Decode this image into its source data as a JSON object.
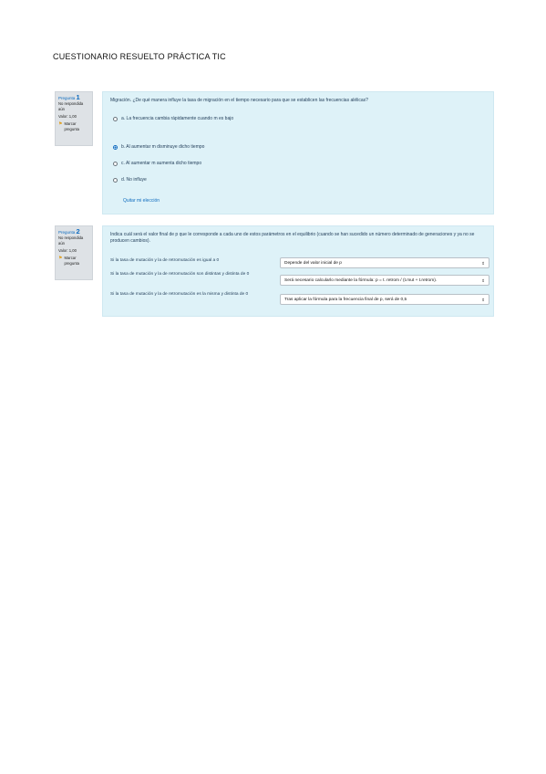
{
  "document": {
    "title": "CUESTIONARIO RESUELTO PRÁCTICA TIC"
  },
  "questions": [
    {
      "label": "Pregunta",
      "number": "1",
      "status": "No respondida aún",
      "grade": "Valor: 1,00",
      "flag_label": "Marcar pregunta",
      "text": "Migración. ¿De qué manera influye la tasa de migración en el tiempo necesario para que se establicen las frecuencias alélicas?",
      "options": [
        {
          "text": "a. La frecuencia cambia rápidamente cuando m es bajo",
          "selected": false
        },
        {
          "text": "b. Al aumentar m disminuye dicho tiempo",
          "selected": true
        },
        {
          "text": "c. Al aumentar m aumenta dicho tiempo",
          "selected": false
        },
        {
          "text": "d. No influye",
          "selected": false
        }
      ],
      "clear_choice": "Quitar mi elección"
    },
    {
      "label": "Pregunta",
      "number": "2",
      "status": "No respondida aún",
      "grade": "Valor: 1,00",
      "flag_label": "Marcar pregunta",
      "text": "Indica cuál será el valor final de p que le corresponde a cada uno de estos parámetros en el equilibrio (cuando se han sucedido un número determinado de generaciones y ya no se producen cambios).",
      "rows": [
        {
          "label": "Si la tasa de mutación y la de retromutación es igual a 0",
          "selected": "Depende del valor inicial de p"
        },
        {
          "label": "Si la tasa de mutación y la de retromutación son distintas y distinta de 0",
          "selected": "Será necesario calcularlo mediante la fórmula: p = t. retrom / (t.mut + t.retrom)."
        },
        {
          "label": "Si la tasa de mutación y la de retromutación es la misma y distinta de 0",
          "selected": "Tras aplicar la fórmula para la frecuencia final de p, será de 0,5"
        }
      ]
    }
  ],
  "icons": {
    "flag": "flag-icon",
    "select_caret": "updown-caret-icon"
  },
  "colors": {
    "accent": "#0f6cbf",
    "content_bg": "#def2f8",
    "info_bg": "#dee2e6",
    "flag": "#e0a020"
  }
}
